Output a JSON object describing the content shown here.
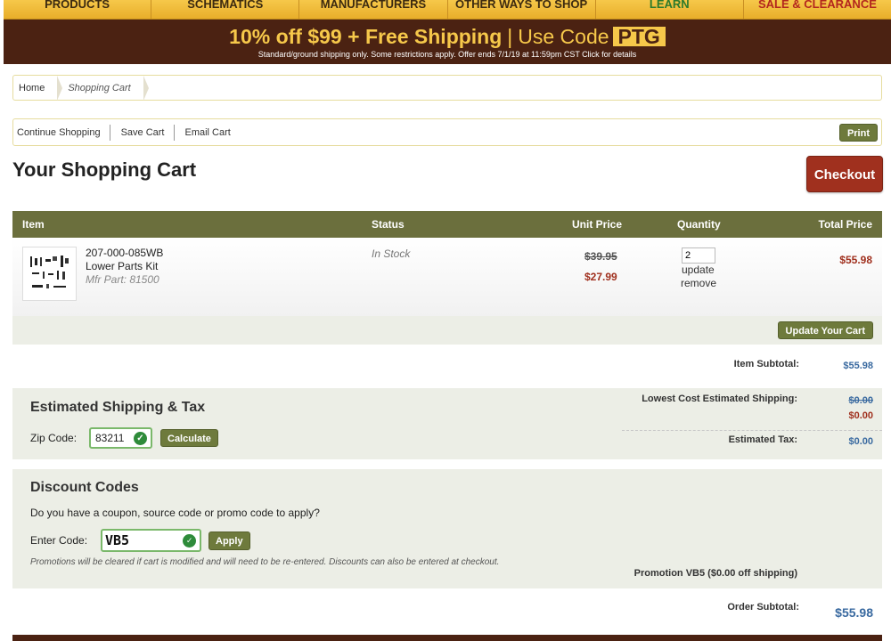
{
  "topnav": {
    "items": [
      "PRODUCTS",
      "SCHEMATICS",
      "MANUFACTURERS",
      "OTHER WAYS TO SHOP",
      "LEARN",
      "SALE & CLEARANCE"
    ]
  },
  "promo": {
    "offer": "10% off $99 + Free Shipping",
    "separator": "|",
    "use_code": "Use Code",
    "code": "PTG",
    "fine_print": "Standard/ground shipping only. Some restrictions apply. Offer ends 7/1/19 at 11:59pm CST Click for details"
  },
  "breadcrumb": {
    "home": "Home",
    "current": "Shopping Cart"
  },
  "cart_actions": {
    "continue": "Continue Shopping",
    "save": "Save Cart",
    "email": "Email Cart",
    "print": "Print"
  },
  "title": "Your Shopping Cart",
  "checkout_label": "Checkout",
  "columns": {
    "item": "Item",
    "status": "Status",
    "unit_price": "Unit Price",
    "quantity": "Quantity",
    "total_price": "Total Price"
  },
  "item": {
    "sku": "207-000-085WB",
    "name": "Lower Parts Kit",
    "mfr_part": "Mfr Part: 81500",
    "status": "In Stock",
    "original_price": "$39.95",
    "sale_price": "$27.99",
    "quantity": "2",
    "update_link": "update",
    "remove_link": "remove",
    "total": "$55.98"
  },
  "update_cart_label": "Update Your Cart",
  "item_subtotal": {
    "label": "Item Subtotal:",
    "value": "$55.98"
  },
  "shipping": {
    "title": "Estimated Shipping & Tax",
    "zip_label": "Zip Code:",
    "zip_value": "83211",
    "calculate_label": "Calculate",
    "lowest_label": "Lowest Cost Estimated Shipping:",
    "lowest_original": "$0.00",
    "lowest_value": "$0.00",
    "tax_label": "Estimated Tax:",
    "tax_value": "$0.00"
  },
  "discount": {
    "title": "Discount Codes",
    "question": "Do you have a coupon, source code or promo code to apply?",
    "code_label": "Enter Code:",
    "code_value": "VB5",
    "apply_label": "Apply",
    "note": "Promotions will be cleared if cart is modified and will need to be re-entered. Discounts can also be entered at checkout.",
    "applied": "Promotion VB5 ($0.00 off shipping)"
  },
  "order_subtotal": {
    "label": "Order Subtotal:",
    "value": "$55.98"
  },
  "colors": {
    "header_olive": "#6b6f3d",
    "button_olive": "#6e7a3c",
    "checkout_red": "#a0301e",
    "banner_brown": "#4b2212",
    "banner_gold": "#f6c84a",
    "value_blue": "#3a6aa0"
  }
}
